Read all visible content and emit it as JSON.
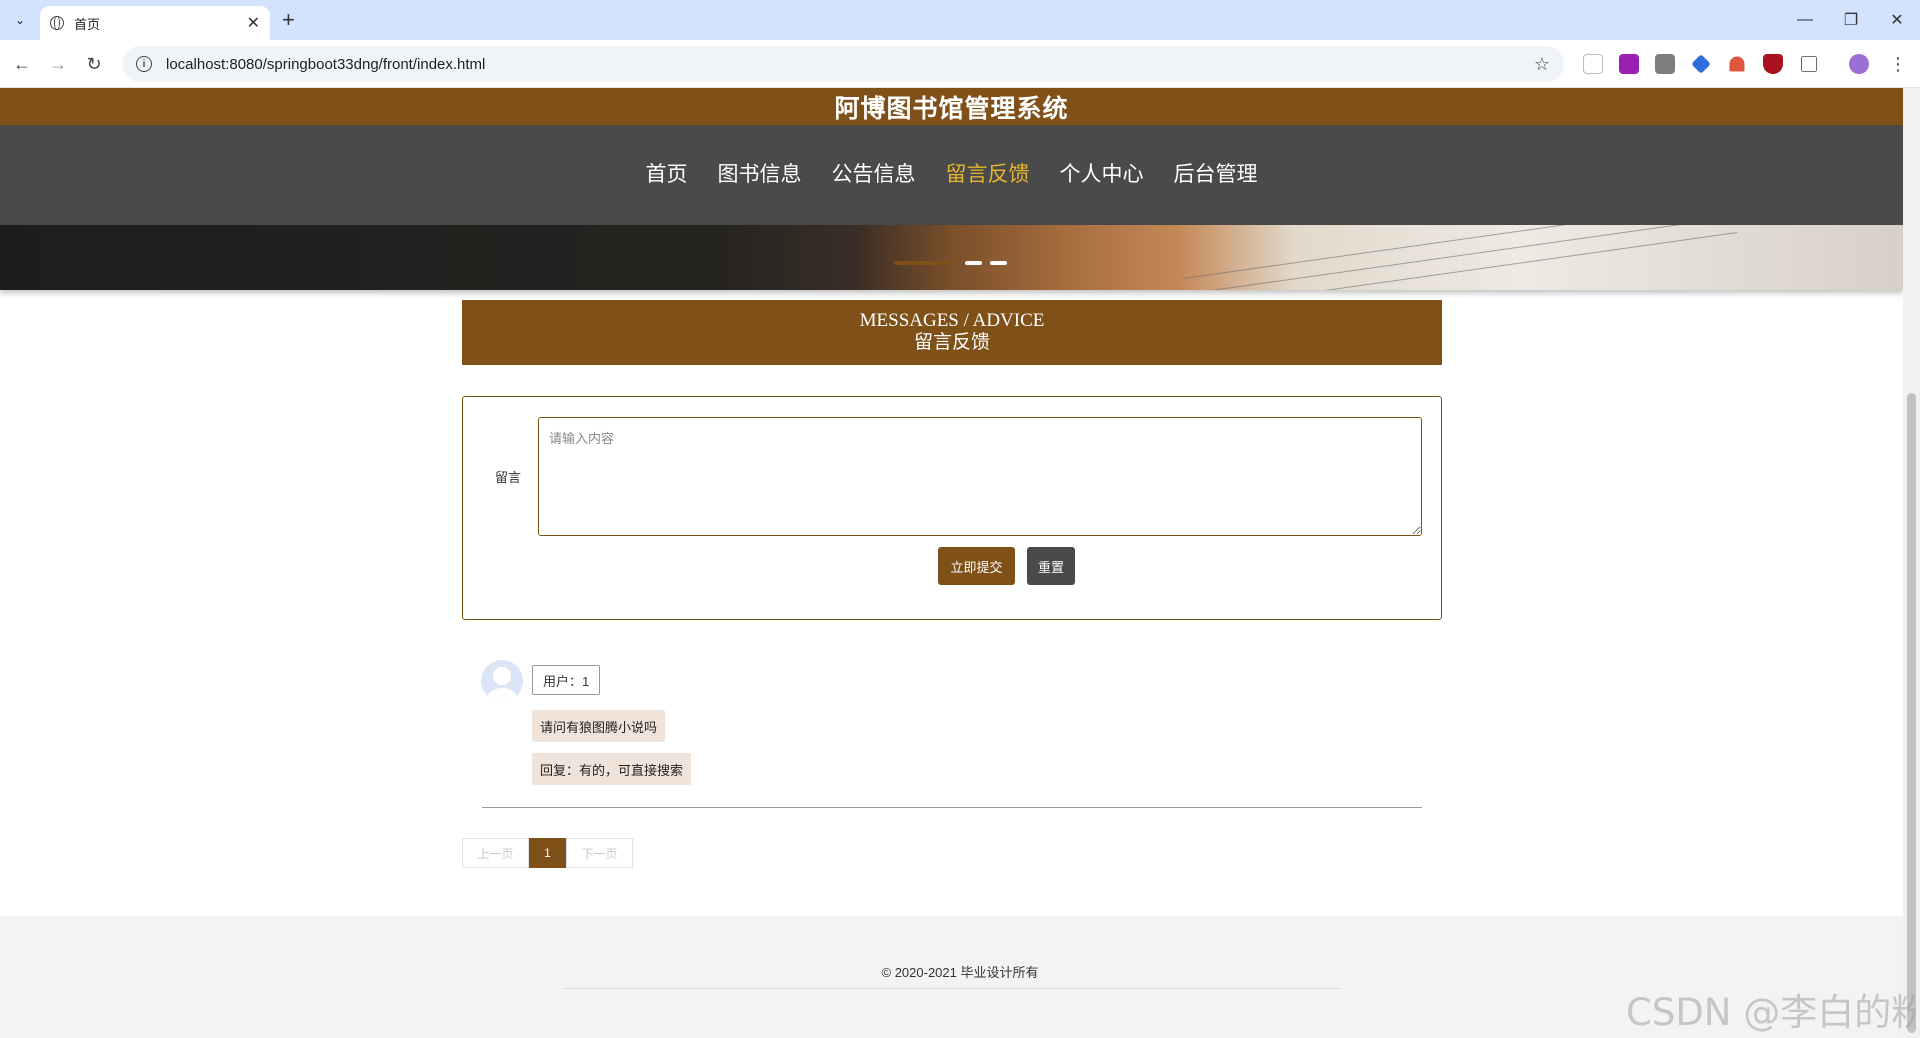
{
  "browser": {
    "tab_title": "首页",
    "url": "localhost:8080/springboot33dng/front/index.html"
  },
  "site": {
    "title": "阿博图书馆管理系统"
  },
  "nav": {
    "items": [
      {
        "label": "首页",
        "active": false
      },
      {
        "label": "图书信息",
        "active": false
      },
      {
        "label": "公告信息",
        "active": false
      },
      {
        "label": "留言反馈",
        "active": true
      },
      {
        "label": "个人中心",
        "active": false
      },
      {
        "label": "后台管理",
        "active": false
      }
    ]
  },
  "section": {
    "title_en": "MESSAGES / ADVICE",
    "title_cn": "留言反馈"
  },
  "form": {
    "label": "留言",
    "placeholder": "请输入内容",
    "submit_label": "立即提交",
    "reset_label": "重置"
  },
  "messages": [
    {
      "user": "用户：1",
      "content": "请问有狼图腾小说吗",
      "reply": "回复：有的，可直接搜索"
    }
  ],
  "pagination": {
    "prev": "上一页",
    "current": "1",
    "next": "下一页"
  },
  "footer": {
    "copyright": "© 2020-2021 毕业设计所有"
  },
  "watermark": "CSDN @李白的粉",
  "colors": {
    "brand": "#7f5018",
    "nav_bg": "#4a4a4a",
    "nav_active": "#e6b432"
  }
}
